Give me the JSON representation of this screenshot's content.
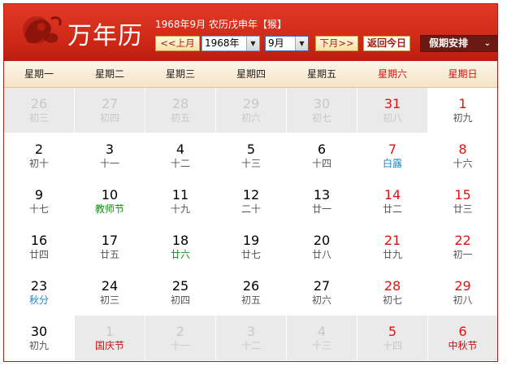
{
  "header": {
    "title": "万年历",
    "info": "1968年9月 农历戊申年【猴】",
    "prev_label": "<<上月",
    "year_value": "1968年",
    "month_value": "9月",
    "next_label": "下月>>",
    "today_label": "返回今日",
    "holiday_label": "假期安排",
    "holiday_arrow": "⌄"
  },
  "colors": {
    "header_red": "#cc2716",
    "weekend_red": "#e0140f",
    "solar_term_blue": "#1a82c4",
    "festival_green": "#138a13"
  },
  "weekdays": [
    "星期一",
    "星期二",
    "星期三",
    "星期四",
    "星期五",
    "星期六",
    "星期日"
  ],
  "weeks": [
    [
      {
        "d": "26",
        "l": "初三",
        "o": true
      },
      {
        "d": "27",
        "l": "初四",
        "o": true
      },
      {
        "d": "28",
        "l": "初五",
        "o": true
      },
      {
        "d": "29",
        "l": "初六",
        "o": true
      },
      {
        "d": "30",
        "l": "初七",
        "o": true
      },
      {
        "d": "31",
        "l": "初八",
        "o": true
      },
      {
        "d": "1",
        "l": "初九"
      }
    ],
    [
      {
        "d": "2",
        "l": "初十"
      },
      {
        "d": "3",
        "l": "十一"
      },
      {
        "d": "4",
        "l": "十二"
      },
      {
        "d": "5",
        "l": "十三"
      },
      {
        "d": "6",
        "l": "十四"
      },
      {
        "d": "7",
        "l": "白露",
        "k": "term"
      },
      {
        "d": "8",
        "l": "十六"
      }
    ],
    [
      {
        "d": "9",
        "l": "十七"
      },
      {
        "d": "10",
        "l": "教师节",
        "k": "fest"
      },
      {
        "d": "11",
        "l": "十九"
      },
      {
        "d": "12",
        "l": "二十"
      },
      {
        "d": "13",
        "l": "廿一"
      },
      {
        "d": "14",
        "l": "廿二"
      },
      {
        "d": "15",
        "l": "廿三"
      }
    ],
    [
      {
        "d": "16",
        "l": "廿四"
      },
      {
        "d": "17",
        "l": "廿五"
      },
      {
        "d": "18",
        "l": "廿六",
        "k": "fest"
      },
      {
        "d": "19",
        "l": "廿七"
      },
      {
        "d": "20",
        "l": "廿八"
      },
      {
        "d": "21",
        "l": "廿九"
      },
      {
        "d": "22",
        "l": "初一"
      }
    ],
    [
      {
        "d": "23",
        "l": "秋分",
        "k": "term"
      },
      {
        "d": "24",
        "l": "初三"
      },
      {
        "d": "25",
        "l": "初四"
      },
      {
        "d": "26",
        "l": "初五"
      },
      {
        "d": "27",
        "l": "初六"
      },
      {
        "d": "28",
        "l": "初七"
      },
      {
        "d": "29",
        "l": "初八"
      }
    ],
    [
      {
        "d": "30",
        "l": "初九"
      },
      {
        "d": "1",
        "l": "国庆节",
        "o": true,
        "k": "red"
      },
      {
        "d": "2",
        "l": "十一",
        "o": true
      },
      {
        "d": "3",
        "l": "十二",
        "o": true
      },
      {
        "d": "4",
        "l": "十三",
        "o": true
      },
      {
        "d": "5",
        "l": "十四",
        "o": true
      },
      {
        "d": "6",
        "l": "中秋节",
        "o": true,
        "k": "red"
      }
    ]
  ]
}
